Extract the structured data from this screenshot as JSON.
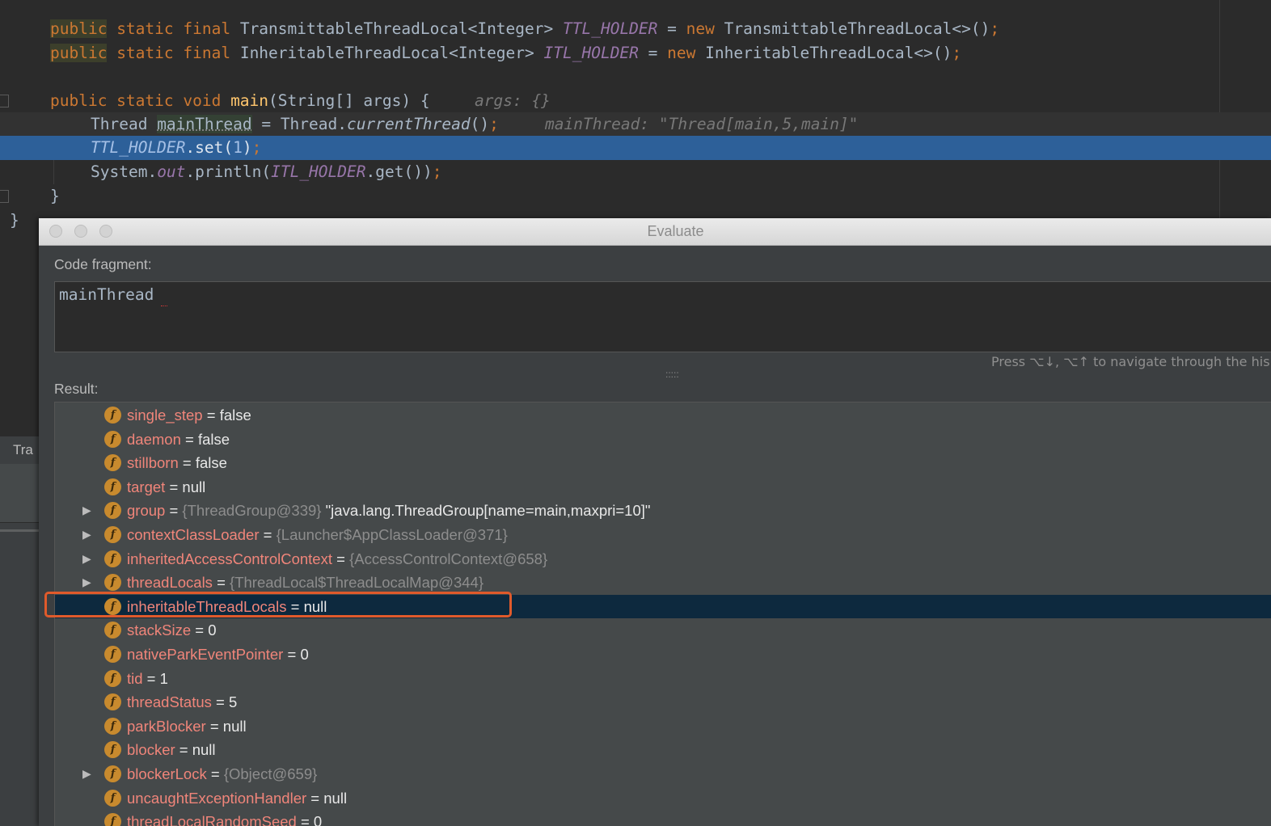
{
  "editor": {
    "lines": {
      "l1": {
        "kw1": "public",
        "kw2": " static final ",
        "type": "TransmittableThreadLocal<Integer> ",
        "field": "TTL_HOLDER",
        "eq": " = ",
        "kw3": "new ",
        "rest": "TransmittableThreadLocal<>()",
        "semi": ";"
      },
      "l2": {
        "kw1": "public",
        "kw2": " static final ",
        "type": "InheritableThreadLocal<Integer> ",
        "field": "ITL_HOLDER",
        "eq": " = ",
        "kw3": "new ",
        "rest": "InheritableThreadLocal<>()",
        "semi": ";"
      },
      "l3": {
        "kw": "public static void ",
        "method": "main",
        "rest": "(String[] args) {",
        "hint": "args: {}"
      },
      "l4": {
        "type": "Thread ",
        "var": "mainThread",
        "eq": " = Thread.",
        "call": "currentThread",
        "rest": "()",
        "semi": ";",
        "hint": "mainThread: \"Thread[main,5,main]\""
      },
      "l5": {
        "field": "TTL_HOLDER",
        "rest": ".set(",
        "num": "1",
        "close": ")",
        "semi": ";"
      },
      "l6": {
        "pre": "System.",
        "out": "out",
        "mid": ".println(",
        "field": "ITL_HOLDER",
        "rest": ".get())",
        "semi": ";"
      },
      "l7": "}",
      "l8": "}"
    }
  },
  "side_panel": {
    "tab_label": "Tra"
  },
  "dialog": {
    "title": "Evaluate",
    "code_fragment_label": "Code fragment:",
    "code_fragment_value": "mainThread",
    "nav_hint": "Press ⌥↓, ⌥↑ to navigate through the his",
    "splitter": ":::::",
    "result_label": "Result:",
    "rows": [
      {
        "name": "single_step",
        "eq": " = ",
        "ref": "",
        "value": "false",
        "expandable": false
      },
      {
        "name": "daemon",
        "eq": " = ",
        "ref": "",
        "value": "false",
        "expandable": false
      },
      {
        "name": "stillborn",
        "eq": " = ",
        "ref": "",
        "value": "false",
        "expandable": false
      },
      {
        "name": "target",
        "eq": " = ",
        "ref": "",
        "value": "null",
        "expandable": false
      },
      {
        "name": "group",
        "eq": " = ",
        "ref": "{ThreadGroup@339} ",
        "value": "\"java.lang.ThreadGroup[name=main,maxpri=10]\"",
        "expandable": true
      },
      {
        "name": "contextClassLoader",
        "eq": " = ",
        "ref": "{Launcher$AppClassLoader@371}",
        "value": "",
        "expandable": true
      },
      {
        "name": "inheritedAccessControlContext",
        "eq": " = ",
        "ref": "{AccessControlContext@658}",
        "value": "",
        "expandable": true
      },
      {
        "name": "threadLocals",
        "eq": " = ",
        "ref": "{ThreadLocal$ThreadLocalMap@344}",
        "value": "",
        "expandable": true
      },
      {
        "name": "inheritableThreadLocals",
        "eq": " = ",
        "ref": "",
        "value": "null",
        "expandable": false,
        "selected": true
      },
      {
        "name": "stackSize",
        "eq": " = ",
        "ref": "",
        "value": "0",
        "expandable": false
      },
      {
        "name": "nativeParkEventPointer",
        "eq": " = ",
        "ref": "",
        "value": "0",
        "expandable": false
      },
      {
        "name": "tid",
        "eq": " = ",
        "ref": "",
        "value": "1",
        "expandable": false
      },
      {
        "name": "threadStatus",
        "eq": " = ",
        "ref": "",
        "value": "5",
        "expandable": false
      },
      {
        "name": "parkBlocker",
        "eq": " = ",
        "ref": "",
        "value": "null",
        "expandable": false
      },
      {
        "name": "blocker",
        "eq": " = ",
        "ref": "",
        "value": "null",
        "expandable": false
      },
      {
        "name": "blockerLock",
        "eq": " = ",
        "ref": "{Object@659}",
        "value": "",
        "expandable": true
      },
      {
        "name": "uncaughtExceptionHandler",
        "eq": " = ",
        "ref": "",
        "value": "null",
        "expandable": false
      },
      {
        "name": "threadLocalRandomSeed",
        "eq": " = ",
        "ref": "",
        "value": "0",
        "expandable": false
      }
    ]
  },
  "colors": {
    "highlight_outline": "#e05a2b",
    "selection": "#0d293e",
    "exec_line": "#2d6099",
    "field_icon": "#c88a2e"
  }
}
